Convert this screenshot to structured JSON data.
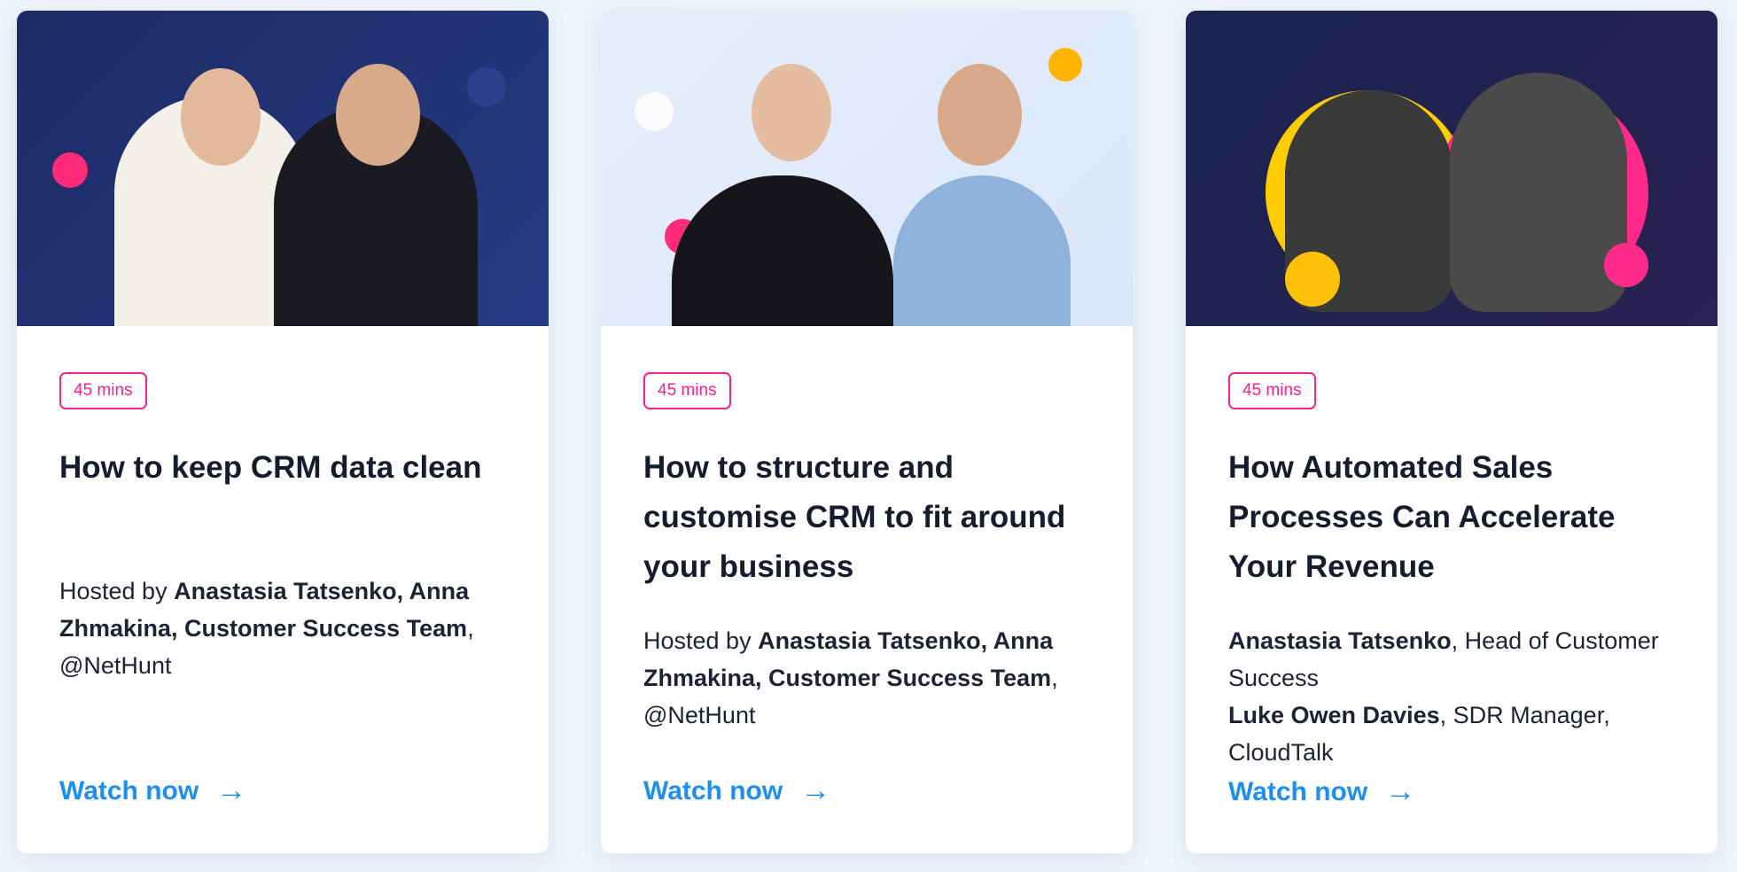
{
  "cards": [
    {
      "duration": "45 mins",
      "title": "How to keep CRM data clean",
      "desc_prefix": "Hosted by ",
      "desc_bold": "Anastasia Tatsenko, Anna Zhmakina, Customer Success Team",
      "desc_suffix": ", @NetHunt",
      "cta": "Watch now",
      "arrow": "→"
    },
    {
      "duration": "45 mins",
      "title": "How to structure and customise CRM to fit around your business",
      "desc_prefix": "Hosted by ",
      "desc_bold": "Anastasia Tatsenko, Anna Zhmakina, Customer Success Team",
      "desc_suffix": ", @NetHunt",
      "cta": "Watch now",
      "arrow": "→"
    },
    {
      "duration": "45 mins",
      "title": "How Automated Sales Processes Can Accelerate Your Revenue",
      "speaker1_name": "Anastasia Tatsenko",
      "speaker1_role": ", Head of Customer Success",
      "speaker2_name": "Luke Owen Davies",
      "speaker2_role": ", SDR Manager, CloudTalk",
      "cta": "Watch now",
      "arrow": "→"
    }
  ],
  "colors": {
    "accent": "#1c8ff0",
    "badge": "#ff1f8e",
    "heading": "#141c2e"
  }
}
